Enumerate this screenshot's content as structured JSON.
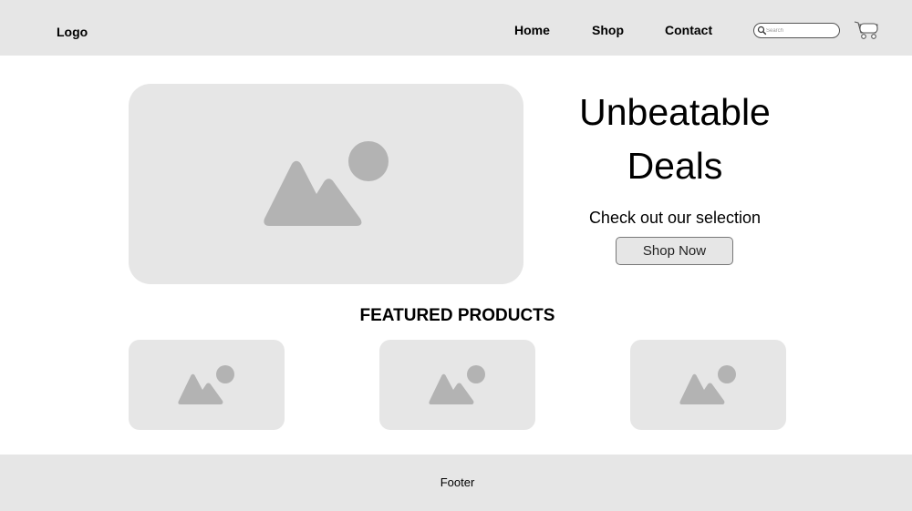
{
  "header": {
    "logo": "Logo",
    "nav": {
      "home": "Home",
      "shop": "Shop",
      "contact": "Contact"
    },
    "search": {
      "placeholder": "Search"
    },
    "cart_icon": "shopping-cart-icon"
  },
  "hero": {
    "image_icon": "image-placeholder-icon",
    "title_line1": "Unbeatable",
    "title_line2": "Deals",
    "subtitle": "Check out our selection",
    "button_label": "Shop Now"
  },
  "featured": {
    "title": "FEATURED PRODUCTS",
    "products": [
      {
        "image_icon": "image-placeholder-icon"
      },
      {
        "image_icon": "image-placeholder-icon"
      },
      {
        "image_icon": "image-placeholder-icon"
      }
    ]
  },
  "footer": {
    "text": "Footer"
  },
  "colors": {
    "panel_gray": "#e6e6e6",
    "icon_gray": "#b3b3b3",
    "text": "#000000"
  }
}
